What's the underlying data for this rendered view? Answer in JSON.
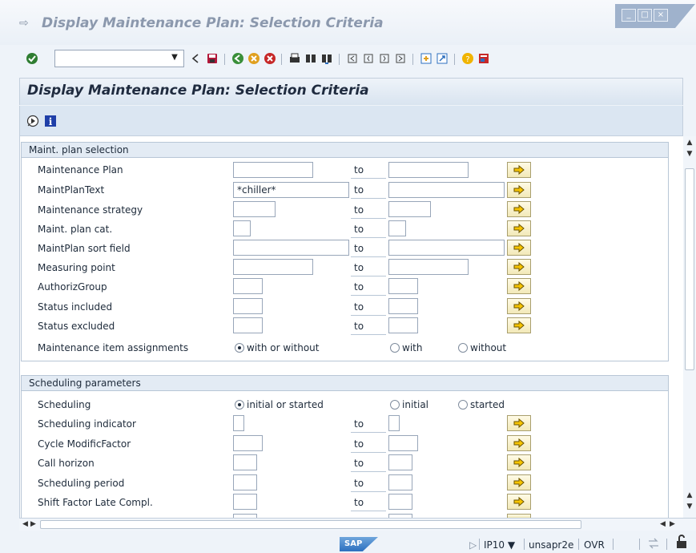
{
  "window": {
    "title": "Display Maintenance Plan: Selection Criteria",
    "controls": [
      "_",
      "□",
      "×"
    ]
  },
  "toolbar": {
    "command_value": "",
    "icons": [
      "enter-icon",
      "back-nav-icon",
      "save-icon",
      "back-icon",
      "exit-icon",
      "cancel-icon",
      "print-icon",
      "find-icon",
      "find-next-icon",
      "first-page-icon",
      "previous-page-icon",
      "next-page-icon",
      "last-page-icon",
      "create-session-icon",
      "shortcut-icon",
      "help-icon",
      "customize-layout-icon"
    ]
  },
  "header": {
    "title": "Display Maintenance Plan: Selection Criteria"
  },
  "app_toolbar": {
    "icons": [
      "execute-icon",
      "info-icon"
    ]
  },
  "sections": {
    "plan_selection": {
      "title": "Maint. plan selection",
      "to_label": "to",
      "rows": [
        {
          "label": "Maintenance Plan",
          "low": "",
          "high": ""
        },
        {
          "label": "MaintPlanText",
          "low": "*chiller*",
          "high": ""
        },
        {
          "label": "Maintenance strategy",
          "low": "",
          "high": ""
        },
        {
          "label": "Maint. plan cat.",
          "low": "",
          "high": ""
        },
        {
          "label": "MaintPlan sort field",
          "low": "",
          "high": ""
        },
        {
          "label": "Measuring point",
          "low": "",
          "high": ""
        },
        {
          "label": "AuthorizGroup",
          "low": "",
          "high": ""
        },
        {
          "label": "Status included",
          "low": "",
          "high": ""
        },
        {
          "label": "Status excluded",
          "low": "",
          "high": ""
        }
      ],
      "item_assign": {
        "label": "Maintenance item assignments",
        "options": [
          "with or without",
          "with",
          "without"
        ],
        "selected": "with or without"
      }
    },
    "scheduling": {
      "title": "Scheduling parameters",
      "radio_row": {
        "label": "Scheduling",
        "options": [
          "initial or started",
          "initial",
          "started"
        ],
        "selected": "initial or started"
      },
      "to_label": "to",
      "rows": [
        {
          "label": "Scheduling indicator",
          "low": "",
          "high": ""
        },
        {
          "label": "Cycle ModificFactor",
          "low": "",
          "high": ""
        },
        {
          "label": "Call horizon",
          "low": "",
          "high": ""
        },
        {
          "label": "Scheduling period",
          "low": "",
          "high": ""
        },
        {
          "label": "Shift Factor Late Compl.",
          "low": "",
          "high": ""
        }
      ]
    }
  },
  "statusbar": {
    "logo": "SAP",
    "system": "IP10",
    "server": "unsapr2e",
    "mode": "OVR"
  },
  "colors": {
    "accent": "#2c6fbf",
    "multisel_button": "#f2e9b8",
    "section_header": "#e3ebf4"
  }
}
